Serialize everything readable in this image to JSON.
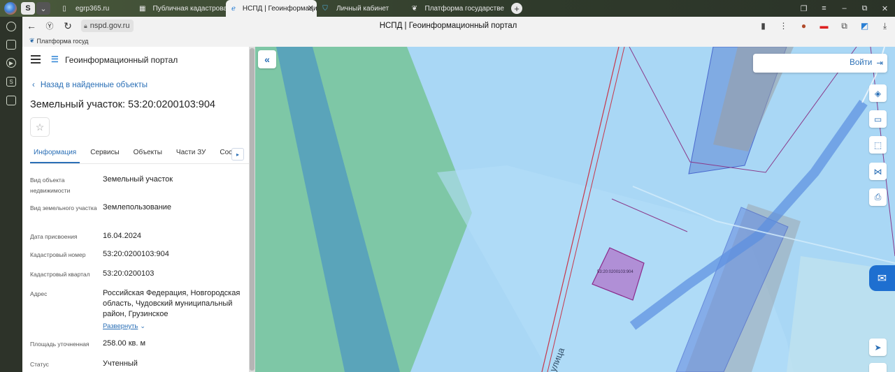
{
  "browser": {
    "tabs": [
      {
        "label": "egrp365.ru",
        "icon": "document-icon"
      },
      {
        "label": "Публичная кадастровая",
        "icon": "map-icon"
      },
      {
        "label": "НСПД | Геоинформаци",
        "icon": "nspd-icon",
        "active": true
      },
      {
        "label": "Личный кабинет",
        "icon": "shield-icon"
      },
      {
        "label": "Платформа государстве",
        "icon": "emblem-icon"
      }
    ],
    "url": "nspd.gov.ru",
    "page_title": "НСПД | Геоинформационный портал",
    "bookmark": "Платформа госуд"
  },
  "panel": {
    "portal_title": "Геоинформационный портал",
    "back_link": "Назад в найденные объекты",
    "object_title": "Земельный участок: 53:20:0200103:904",
    "tabs": [
      "Информация",
      "Сервисы",
      "Объекты",
      "Части ЗУ",
      "Состав"
    ],
    "fields": [
      {
        "key": "Вид объекта недвижимости",
        "value": "Земельный участок"
      },
      {
        "key": "Вид земельного участка",
        "value": "Землепользование"
      },
      {
        "key": "Дата присвоения",
        "value": "16.04.2024"
      },
      {
        "key": "Кадастровый номер",
        "value": "53:20:0200103:904"
      },
      {
        "key": "Кадастровый квартал",
        "value": "53:20:0200103"
      },
      {
        "key": "Адрес",
        "value": "Российская Федерация, Новгородская область, Чудовский муниципальный район, Грузинское"
      },
      {
        "key": "Площадь уточненная",
        "value": "258.00 кв. м"
      },
      {
        "key": "Статус",
        "value": "Учтенный"
      }
    ],
    "expand_label": "Развернуть"
  },
  "map": {
    "login": "Войти",
    "parcel_label": "53:20:0200103:904",
    "street_label": "улица"
  }
}
